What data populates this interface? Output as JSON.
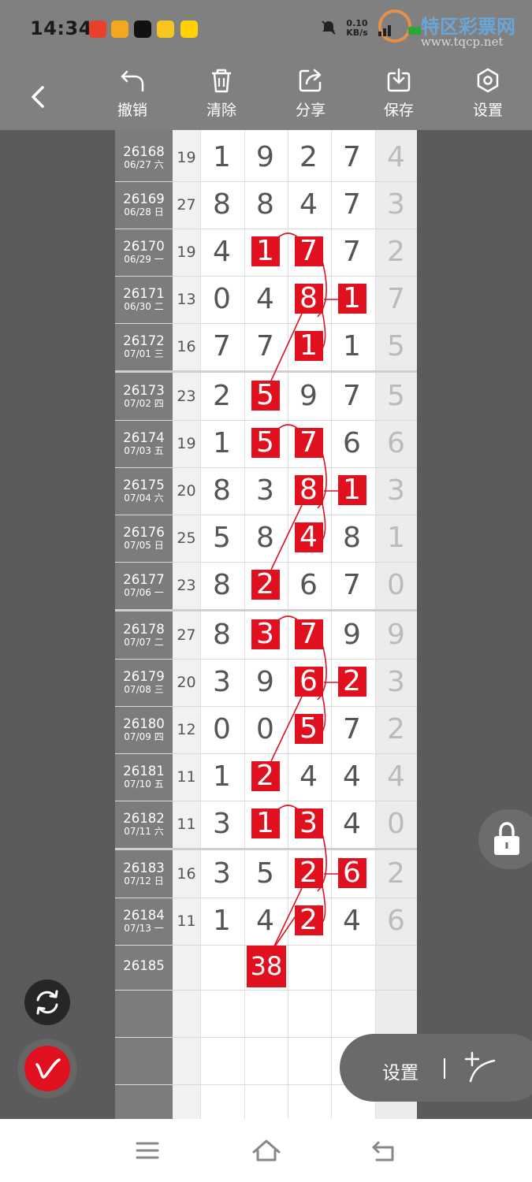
{
  "status": {
    "time": "14:34",
    "net_speed_value": "0.10",
    "net_speed_unit": "KB/s",
    "signal": "5G"
  },
  "watermark": {
    "title": "特区彩票网",
    "url": "www.tqcp.net"
  },
  "toolbar": {
    "undo": "撤销",
    "clear": "清除",
    "share": "分享",
    "save": "保存",
    "settings": "设置"
  },
  "rows": [
    {
      "issue": "26168",
      "date": "06/27 六",
      "sum": "19",
      "d": [
        "1",
        "9",
        "2",
        "7"
      ],
      "tail": "4"
    },
    {
      "issue": "26169",
      "date": "06/28 日",
      "sum": "27",
      "d": [
        "8",
        "8",
        "4",
        "7"
      ],
      "tail": "3"
    },
    {
      "issue": "26170",
      "date": "06/29 一",
      "sum": "19",
      "d": [
        "4",
        "1",
        "7",
        "7"
      ],
      "tail": "2"
    },
    {
      "issue": "26171",
      "date": "06/30 二",
      "sum": "13",
      "d": [
        "0",
        "4",
        "8",
        "1"
      ],
      "tail": "7"
    },
    {
      "issue": "26172",
      "date": "07/01 三",
      "sum": "16",
      "d": [
        "7",
        "7",
        "1",
        "1"
      ],
      "tail": "5"
    },
    {
      "issue": "26173",
      "date": "07/02 四",
      "sum": "23",
      "d": [
        "2",
        "5",
        "9",
        "7"
      ],
      "tail": "5"
    },
    {
      "issue": "26174",
      "date": "07/03 五",
      "sum": "19",
      "d": [
        "1",
        "5",
        "7",
        "6"
      ],
      "tail": "6"
    },
    {
      "issue": "26175",
      "date": "07/04 六",
      "sum": "20",
      "d": [
        "8",
        "3",
        "8",
        "1"
      ],
      "tail": "3"
    },
    {
      "issue": "26176",
      "date": "07/05 日",
      "sum": "25",
      "d": [
        "5",
        "8",
        "4",
        "8"
      ],
      "tail": "1"
    },
    {
      "issue": "26177",
      "date": "07/06 一",
      "sum": "23",
      "d": [
        "8",
        "2",
        "6",
        "7"
      ],
      "tail": "0"
    },
    {
      "issue": "26178",
      "date": "07/07 二",
      "sum": "27",
      "d": [
        "8",
        "3",
        "7",
        "9"
      ],
      "tail": "9"
    },
    {
      "issue": "26179",
      "date": "07/08 三",
      "sum": "20",
      "d": [
        "3",
        "9",
        "6",
        "2"
      ],
      "tail": "3"
    },
    {
      "issue": "26180",
      "date": "07/09 四",
      "sum": "12",
      "d": [
        "0",
        "0",
        "5",
        "7"
      ],
      "tail": "2"
    },
    {
      "issue": "26181",
      "date": "07/10 五",
      "sum": "11",
      "d": [
        "1",
        "2",
        "4",
        "4"
      ],
      "tail": "4"
    },
    {
      "issue": "26182",
      "date": "07/11 六",
      "sum": "11",
      "d": [
        "3",
        "1",
        "3",
        "4"
      ],
      "tail": "0"
    },
    {
      "issue": "26183",
      "date": "07/12 日",
      "sum": "16",
      "d": [
        "3",
        "5",
        "2",
        "6"
      ],
      "tail": "2"
    },
    {
      "issue": "26184",
      "date": "07/13 一",
      "sum": "11",
      "d": [
        "1",
        "4",
        "2",
        "4"
      ],
      "tail": "6"
    }
  ],
  "highlights": [
    [
      2,
      1
    ],
    [
      2,
      2
    ],
    [
      3,
      2
    ],
    [
      3,
      3
    ],
    [
      4,
      2
    ],
    [
      5,
      1
    ],
    [
      6,
      1
    ],
    [
      6,
      2
    ],
    [
      7,
      2
    ],
    [
      7,
      3
    ],
    [
      8,
      2
    ],
    [
      9,
      1
    ],
    [
      10,
      1
    ],
    [
      10,
      2
    ],
    [
      11,
      2
    ],
    [
      11,
      3
    ],
    [
      12,
      2
    ],
    [
      13,
      1
    ],
    [
      14,
      1
    ],
    [
      14,
      2
    ],
    [
      15,
      2
    ],
    [
      15,
      3
    ],
    [
      16,
      2
    ]
  ],
  "next_issue": "26185",
  "prediction_value": "38",
  "float_panel": {
    "settings_label": "设置"
  },
  "colors": {
    "highlight": "#e0101e",
    "issue_bg": "#7c7c7c",
    "toolbar_bg": "#808080"
  }
}
